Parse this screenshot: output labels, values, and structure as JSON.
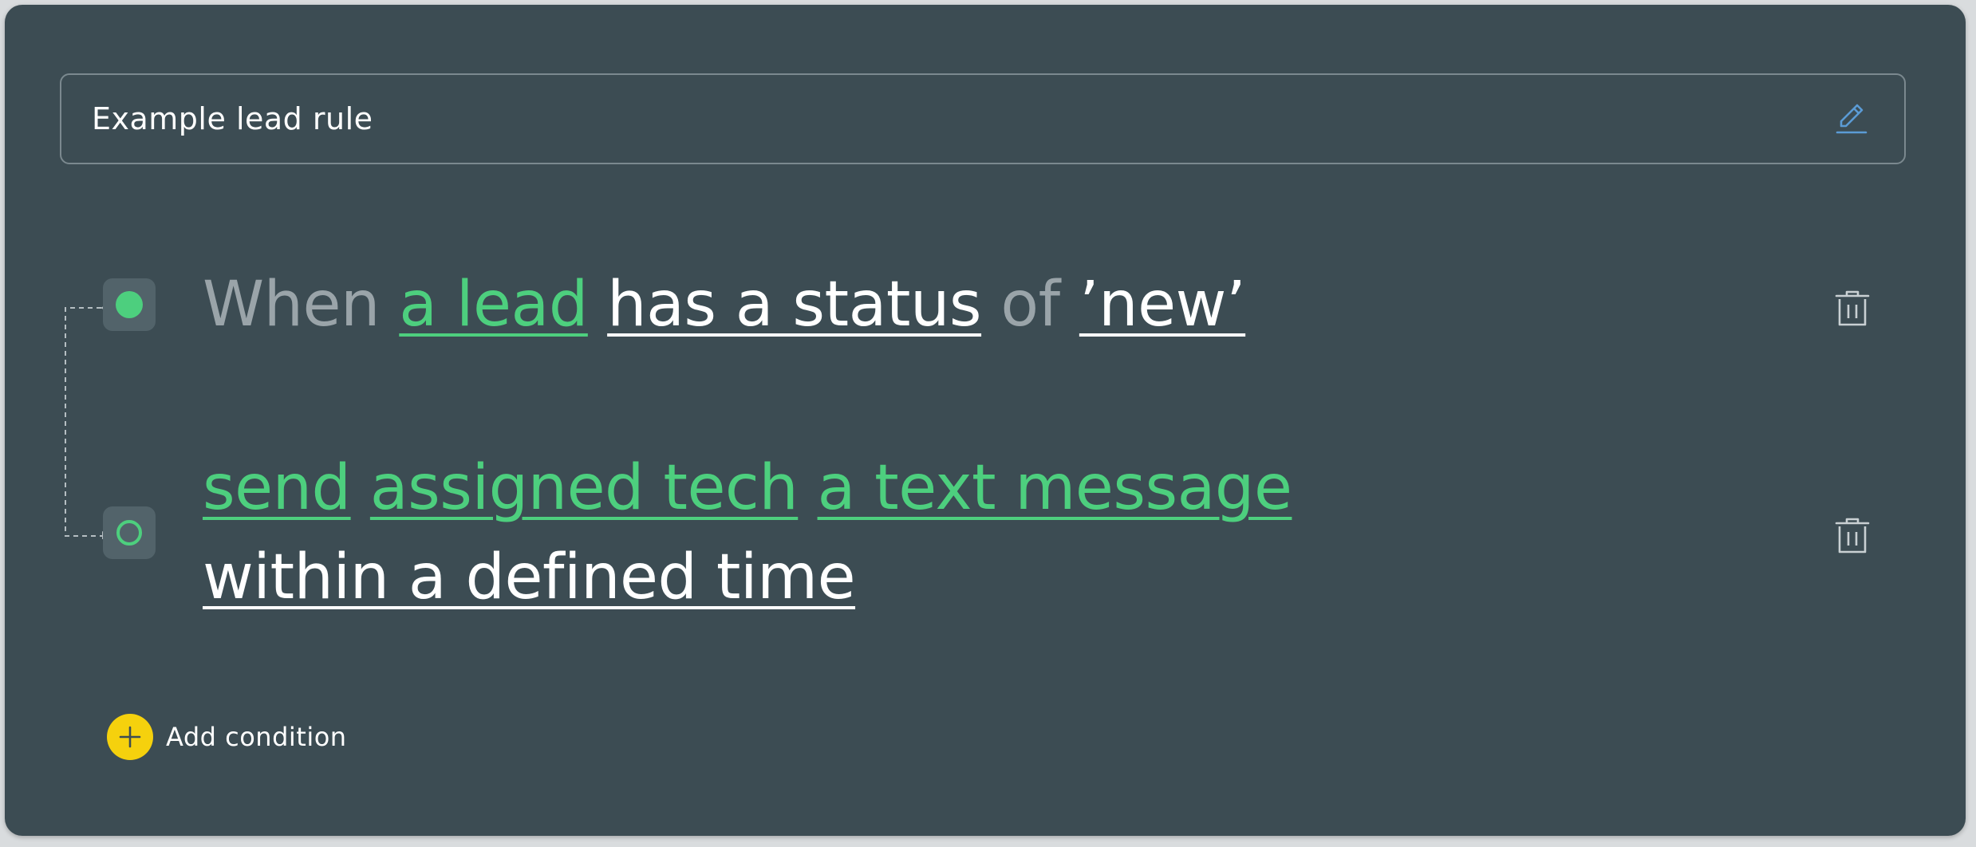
{
  "rule": {
    "title": "Example lead rule"
  },
  "condition": {
    "word_when": "When",
    "subject": "a lead",
    "predicate": "has a status",
    "word_of": "of",
    "value": "’new’"
  },
  "action": {
    "verb": "send",
    "target": "assigned tech",
    "message": "a text message",
    "timing": "within a defined time"
  },
  "footer": {
    "add_condition_label": "Add condition"
  },
  "colors": {
    "background": "#3c4c53",
    "accent_green": "#4dcf7e",
    "add_yellow": "#f5d10d",
    "edit_blue": "#5b9bd5"
  },
  "icons": {
    "edit": "pencil-icon",
    "delete": "trash-icon",
    "add": "plus-icon"
  }
}
